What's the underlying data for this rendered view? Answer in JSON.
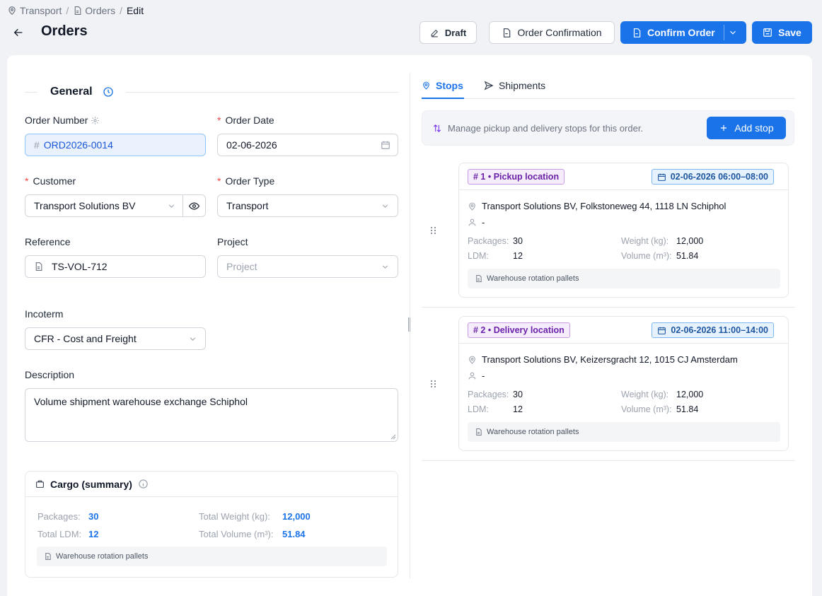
{
  "breadcrumb": {
    "item1": "Transport",
    "item2": "Orders",
    "item3": "Edit",
    "sep": "/"
  },
  "header": {
    "title": "Orders",
    "draft_label": "Draft",
    "order_confirmation_label": "Order Confirmation",
    "confirm_order_label": "Confirm Order",
    "save_label": "Save"
  },
  "general": {
    "section_title": "General",
    "order_number": {
      "label": "Order Number",
      "value": "ORD2026-0014"
    },
    "order_date": {
      "label": "Order Date",
      "value": "02-06-2026"
    },
    "customer": {
      "label": "Customer",
      "value": "Transport Solutions BV"
    },
    "order_type": {
      "label": "Order Type",
      "value": "Transport"
    },
    "reference": {
      "label": "Reference",
      "value": "TS-VOL-712"
    },
    "project": {
      "label": "Project",
      "placeholder": "Project"
    },
    "incoterm": {
      "label": "Incoterm",
      "value": "CFR - Cost and Freight"
    },
    "description": {
      "label": "Description",
      "value": "Volume shipment warehouse exchange Schiphol"
    }
  },
  "cargo": {
    "title": "Cargo (summary)",
    "packages_label": "Packages:",
    "packages": "30",
    "ldm_label": "Total LDM:",
    "ldm": "12",
    "weight_label": "Total Weight (kg):",
    "weight": "12,000",
    "volume_label": "Total Volume (m³):",
    "volume": "51.84",
    "note": "Warehouse rotation pallets"
  },
  "tabs": {
    "stops": "Stops",
    "shipments": "Shipments"
  },
  "banner": {
    "text": "Manage pickup and delivery stops for this order.",
    "add_stop_label": "Add stop"
  },
  "stops": [
    {
      "badge": "# 1 • Pickup location",
      "time": "02-06-2026 06:00–08:00",
      "address": "Transport Solutions BV, Folkstoneweg 44, 1118 LN Schiphol",
      "contact": "-",
      "packages_label": "Packages:",
      "packages": "30",
      "ldm_label": "LDM:",
      "ldm": "12",
      "weight_label": "Weight (kg):",
      "weight": "12,000",
      "volume_label": "Volume (m³):",
      "volume": "51.84",
      "note": "Warehouse rotation pallets"
    },
    {
      "badge": "# 2 • Delivery location",
      "time": "02-06-2026 11:00–14:00",
      "address": "Transport Solutions BV, Keizersgracht 12, 1015 CJ Amsterdam",
      "contact": "-",
      "packages_label": "Packages:",
      "packages": "30",
      "ldm_label": "LDM:",
      "ldm": "12",
      "weight_label": "Weight (kg):",
      "weight": "12,000",
      "volume_label": "Volume (m³):",
      "volume": "51.84",
      "note": "Warehouse rotation pallets"
    }
  ],
  "colors": {
    "accent": "#1a73e8",
    "badge_purple": "#6b21a8",
    "badge_blue": "#1e56a0",
    "required": "#ef4444"
  }
}
